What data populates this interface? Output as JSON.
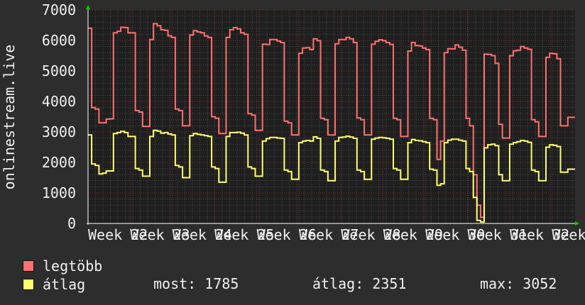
{
  "chart_data": {
    "type": "line",
    "ylabel": "onlinestream.live",
    "ylim": [
      0,
      7000
    ],
    "yticks": [
      0,
      1000,
      2000,
      3000,
      4000,
      5000,
      6000,
      7000
    ],
    "x_tick_labels": [
      "Week 22",
      "Week 23",
      "Week 24",
      "Week 25",
      "Week 26",
      "Week 27",
      "Week 28",
      "Week 29",
      "Week 30",
      "Week 31",
      "Week 32",
      "Week 33"
    ],
    "grid": true,
    "legend_placement": "bottom-left",
    "series": [
      {
        "name": "legtöbb",
        "color": "#ff7070",
        "values": [
          6400,
          3800,
          3750,
          3300,
          3300,
          3420,
          3430,
          6250,
          6300,
          6430,
          6420,
          6250,
          6250,
          3700,
          3650,
          3180,
          3180,
          6030,
          6550,
          6480,
          6350,
          6330,
          6150,
          6100,
          3750,
          3700,
          3200,
          3200,
          6180,
          6320,
          6280,
          6250,
          6150,
          6100,
          3500,
          3450,
          2950,
          2950,
          6100,
          6350,
          6420,
          6380,
          6250,
          6200,
          3600,
          3550,
          3050,
          3050,
          5880,
          5870,
          6030,
          6030,
          5980,
          5930,
          3350,
          3300,
          2900,
          2900,
          5580,
          5750,
          5760,
          5700,
          6050,
          5990,
          3450,
          3400,
          2900,
          2900,
          5890,
          6030,
          6030,
          6100,
          6050,
          5930,
          3460,
          3400,
          2900,
          2900,
          5880,
          5970,
          6020,
          5990,
          5930,
          5870,
          3450,
          3400,
          2850,
          2850,
          5650,
          5930,
          5830,
          5820,
          5750,
          5700,
          3450,
          3400,
          2100,
          2700,
          5600,
          5730,
          5720,
          5850,
          5780,
          5680,
          3450,
          3200,
          1600,
          600,
          200,
          5550,
          5540,
          5500,
          5250,
          3250,
          2800,
          2800,
          5500,
          5660,
          5680,
          5800,
          5750,
          5710,
          3400,
          3330,
          2850,
          2850,
          5450,
          5580,
          5560,
          5400,
          3200,
          3200,
          3480,
          3480
        ]
      },
      {
        "name": "átlag",
        "color": "#ffff70",
        "values": [
          2900,
          1950,
          1900,
          1620,
          1650,
          1720,
          1720,
          2950,
          2980,
          3020,
          2980,
          2850,
          2850,
          1800,
          1750,
          1550,
          1550,
          2850,
          3050,
          3030,
          2960,
          2980,
          2930,
          2900,
          1900,
          1850,
          1500,
          1500,
          2880,
          2950,
          2920,
          2900,
          2880,
          2850,
          1850,
          1800,
          1350,
          1350,
          2850,
          2980,
          2980,
          2990,
          2960,
          2900,
          1850,
          1800,
          1550,
          1550,
          2700,
          2780,
          2820,
          2820,
          2800,
          2790,
          1750,
          1700,
          1450,
          1450,
          2650,
          2700,
          2720,
          2700,
          2840,
          2790,
          1750,
          1700,
          1400,
          1400,
          2700,
          2820,
          2830,
          2860,
          2830,
          2790,
          1750,
          1700,
          1450,
          1450,
          2760,
          2800,
          2820,
          2810,
          2790,
          2760,
          1800,
          1750,
          1450,
          1450,
          2650,
          2750,
          2720,
          2710,
          2680,
          2650,
          1780,
          1750,
          1250,
          1300,
          2650,
          2730,
          2760,
          2760,
          2730,
          2700,
          1800,
          1700,
          850,
          100,
          50,
          2480,
          2580,
          2600,
          2550,
          1600,
          1400,
          1400,
          2600,
          2650,
          2680,
          2720,
          2700,
          2660,
          1750,
          1700,
          1400,
          1400,
          2500,
          2580,
          2560,
          2520,
          1680,
          1680,
          1780,
          1780
        ]
      }
    ]
  },
  "legend": [
    {
      "label": "legtöbb",
      "color": "#ff7070"
    },
    {
      "label": "átlag",
      "color": "#ffff70"
    }
  ],
  "stats": {
    "most": "most: 1785",
    "atlag": "átlag: 2351",
    "max": "max: 3052"
  }
}
